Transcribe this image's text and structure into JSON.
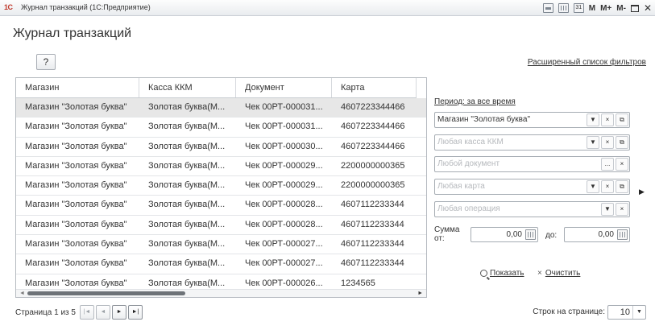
{
  "window": {
    "logo": "1С",
    "title": "Журнал транзакций (1С:Предприятие)",
    "controls": {
      "calendar_text": "31",
      "m": "M",
      "mplus": "M+",
      "mminus": "M-",
      "close": "✕"
    }
  },
  "page": {
    "title": "Журнал транзакций",
    "help_label": "?",
    "extended_filters": "Расширенный список фильтров"
  },
  "table": {
    "columns": [
      "Магазин",
      "Касса ККМ",
      "Документ",
      "Карта"
    ],
    "rows": [
      [
        "Магазин \"Золотая буква\"",
        "Золотая буква(М...",
        "Чек 00РТ-000031...",
        "4607223344466"
      ],
      [
        "Магазин \"Золотая буква\"",
        "Золотая буква(М...",
        "Чек 00РТ-000031...",
        "4607223344466"
      ],
      [
        "Магазин \"Золотая буква\"",
        "Золотая буква(М...",
        "Чек 00РТ-000030...",
        "4607223344466"
      ],
      [
        "Магазин \"Золотая буква\"",
        "Золотая буква(М...",
        "Чек 00РТ-000029...",
        "2200000000365"
      ],
      [
        "Магазин \"Золотая буква\"",
        "Золотая буква(М...",
        "Чек 00РТ-000029...",
        "2200000000365"
      ],
      [
        "Магазин \"Золотая буква\"",
        "Золотая буква(М...",
        "Чек 00РТ-000028...",
        "4607112233344"
      ],
      [
        "Магазин \"Золотая буква\"",
        "Золотая буква(М...",
        "Чек 00РТ-000028...",
        "4607112233344"
      ],
      [
        "Магазин \"Золотая буква\"",
        "Золотая буква(М...",
        "Чек 00РТ-000027...",
        "4607112233344"
      ],
      [
        "Магазин \"Золотая буква\"",
        "Золотая буква(М...",
        "Чек 00РТ-000027...",
        "4607112233344"
      ],
      [
        "Магазин \"Золотая буква\"",
        "Золотая буква(М...",
        "Чек 00РТ-000026...",
        "1234565"
      ]
    ],
    "selected_row": 0
  },
  "pager": {
    "label": "Страница 1 из 5",
    "first": "|◄",
    "prev": "◄",
    "next": "►",
    "last": "►|",
    "rows_label": "Строк на странице:",
    "rows_value": "10",
    "rows_dropdown": "▼"
  },
  "filters": {
    "period": "Период: за все время",
    "shop": {
      "value": "Магазин \"Золотая буква\""
    },
    "kkm": {
      "placeholder": "Любая касса ККМ"
    },
    "document": {
      "placeholder": "Любой документ"
    },
    "card": {
      "placeholder": "Любая карта"
    },
    "operation": {
      "placeholder": "Любая операция"
    },
    "sum_label_1": "Сумма",
    "sum_label_2": "от:",
    "sum_from": "0,00",
    "sum_to_label": "до:",
    "sum_to": "0,00",
    "show": "Показать",
    "clear": "Очистить",
    "glyphs": {
      "dropdown": "▼",
      "clear": "×",
      "open": "⧉",
      "select": "...",
      "side_arrow": "▶",
      "clear_x": "×"
    }
  },
  "colors": {
    "selected_row": "#e7e7e7",
    "border": "#a6acb3",
    "placeholder": "#b6b9bd",
    "scroll_thumb": "#6e7378"
  }
}
